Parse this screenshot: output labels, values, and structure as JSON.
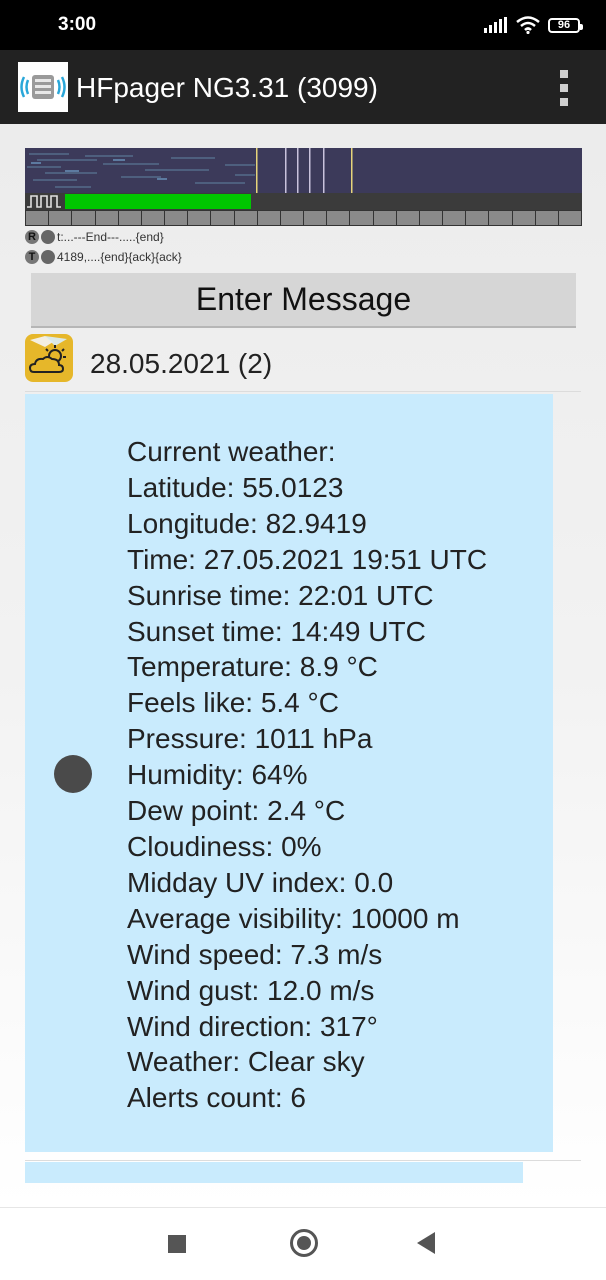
{
  "status_bar": {
    "time": "3:00",
    "battery": "96",
    "icons": [
      "signal-icon",
      "wifi-icon",
      "battery-icon"
    ]
  },
  "app_bar": {
    "title": "HFpager NG3.31 (3099)",
    "icons": [
      "app-logo-icon",
      "overflow-menu-icon"
    ]
  },
  "signal_panel": {
    "progress_percent": 36,
    "rx_label": "R",
    "rx_text": "t:...---End---.....{end}",
    "tx_label": "T",
    "tx_text": "4189,....{end}{ack}{ack}"
  },
  "enter_button": {
    "label": "Enter Message"
  },
  "message": {
    "icon": "weather-cloud-sun-icon",
    "date": "28.05.2021 (2)",
    "lines": [
      "Current weather:",
      "Latitude: 55.0123",
      "Longitude: 82.9419",
      "Time: 27.05.2021 19:51 UTC",
      "Sunrise time: 22:01 UTC",
      "Sunset time: 14:49 UTC",
      "Temperature: 8.9 °C",
      "Feels like: 5.4 °C",
      "Pressure: 1011 hPa",
      "Humidity: 64%",
      "Dew point: 2.4 °C",
      "Cloudiness: 0%",
      "Midday UV index: 0.0",
      "Average visibility: 10000 m",
      "Wind speed: 7.3 m/s",
      "Wind gust: 12.0 m/s",
      "Wind direction: 317°",
      "Weather: Clear sky",
      "Alerts count: 6"
    ]
  },
  "colors": {
    "app_bar": "#222222",
    "progress": "#00c700",
    "bubble": "#c9ebfd",
    "waterfall": "#3c3a5a"
  },
  "nav_bar": {
    "icons": [
      "recents-square-icon",
      "home-circle-icon",
      "back-triangle-icon"
    ]
  }
}
